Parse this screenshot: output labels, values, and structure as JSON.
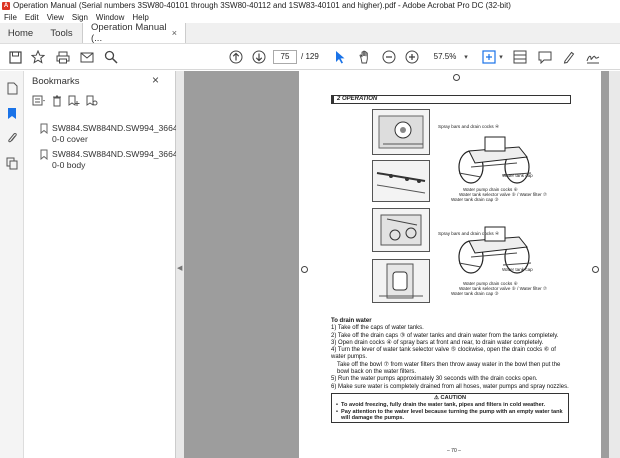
{
  "window": {
    "title": "Operation Manual (Serial numbers 3SW80-40101 through 3SW80-40112 and 1SW83-40101 and higher).pdf - Adobe Acrobat Pro DC (32-bit)"
  },
  "menu": [
    "File",
    "Edit",
    "View",
    "Sign",
    "Window",
    "Help"
  ],
  "tabs": {
    "home": "Home",
    "tools": "Tools",
    "document": "Operation Manual (...",
    "close": "×"
  },
  "toolbar": {
    "page_current": "75",
    "page_total": "/ 129",
    "zoom": "57.5%"
  },
  "bookmarks": {
    "title": "Bookmarks",
    "close": "×",
    "items": [
      {
        "label": "SW884.SW884ND.SW994_3664 0-0 cover"
      },
      {
        "label": "SW884.SW884ND.SW994_3664 0-0 body"
      }
    ]
  },
  "document": {
    "section": "2   OPERATION",
    "callouts": {
      "spray_bars_cocks_1": "Spray bars and drain cocks ④",
      "water_tank_cap_1": "Water tank cap",
      "pump_drain_cocks_1": "Water pump drain cocks ⑥",
      "selector_valve_1": "Water tank selector valve ⑤ / Water filter ⑦",
      "water_tank_drain_cap_1": "Water tank drain cap ③",
      "spray_bars_cocks_2": "Spray bars and drain cocks ④",
      "water_tank_cap_2": "Water tank cap",
      "pump_drain_cocks_2": "Water pump drain cocks ⑥",
      "selector_valve_2": "Water tank selector valve ⑤ / Water filter ⑦",
      "water_tank_drain_cap_2": "Water tank drain cap ③"
    },
    "heading": "To drain water",
    "steps": [
      "1) Take off the caps of water tanks.",
      "2) Take off the drain caps ③ of water tanks and drain water from the tanks completely.",
      "3) Open drain cocks ④ of spray bars at front and rear, to drain water completely.",
      "4) Turn the lever of water tank selector valve ⑤ clockwise, open the drain cocks ⑥ of water pumps.",
      "   Take off the bowl ⑦ from water filters then throw away water in the bowl then put the bowl back on the water filters.",
      "5) Run the water pumps approximately 30 seconds with the drain cocks open.",
      "6) Make sure water is completely drained from all hoses, water pumps and spray nozzles."
    ],
    "caution": {
      "title": "⚠ CAUTION",
      "items": [
        "To avoid freezing, fully drain the water tank, pipes and filters in cold weather.",
        "Pay attention to the water level because turning the pump with an empty water tank will damage the pumps."
      ]
    },
    "page_number": "– 70 –"
  }
}
